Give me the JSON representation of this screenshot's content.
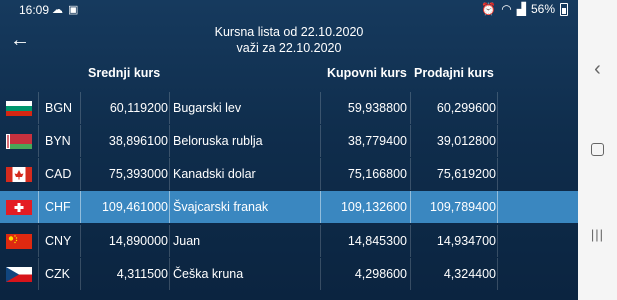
{
  "status": {
    "time": "16:09",
    "battery": "56%"
  },
  "header": {
    "title_line1": "Kursna lista od 22.10.2020",
    "title_line2": "važi za 22.10.2020"
  },
  "columns": {
    "middle": "Srednji kurs",
    "buy": "Kupovni kurs",
    "sell": "Prodajni kurs"
  },
  "rows": [
    {
      "code": "BGN",
      "middle": "60,119200",
      "name": "Bugarski lev",
      "buy": "59,938800",
      "sell": "60,299600",
      "flag": "bulgaria-flag-icon"
    },
    {
      "code": "BYN",
      "middle": "38,896100",
      "name": "Beloruska rublja",
      "buy": "38,779400",
      "sell": "39,012800",
      "flag": "belarus-flag-icon"
    },
    {
      "code": "CAD",
      "middle": "75,393000",
      "name": "Kanadski dolar",
      "buy": "75,166800",
      "sell": "75,619200",
      "flag": "canada-flag-icon"
    },
    {
      "code": "CHF",
      "middle": "109,461000",
      "name": "Švajcarski franak",
      "buy": "109,132600",
      "sell": "109,789400",
      "flag": "switzerland-flag-icon",
      "selected": true
    },
    {
      "code": "CNY",
      "middle": "14,890000",
      "name": "Juan",
      "buy": "14,845300",
      "sell": "14,934700",
      "flag": "china-flag-icon"
    },
    {
      "code": "CZK",
      "middle": "4,311500",
      "name": "Češka kruna",
      "buy": "4,298600",
      "sell": "4,324400",
      "flag": "czech-flag-icon"
    }
  ],
  "colors": {
    "background": "#163a5e",
    "selected_row": "#3a87c0"
  }
}
